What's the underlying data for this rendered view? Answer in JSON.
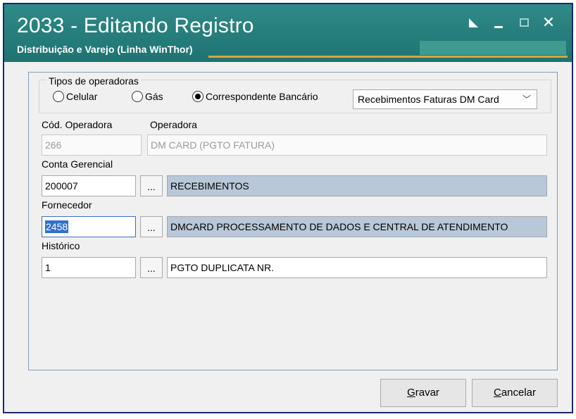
{
  "window": {
    "title": "2033 - Editando Registro",
    "subtitle": "Distribuição e Varejo (Linha WinThor)",
    "close_glyph": "✕"
  },
  "operator_types": {
    "legend": "Tipos de operadoras",
    "options": [
      {
        "label": "Celular",
        "checked": false
      },
      {
        "label": "Gás",
        "checked": false
      },
      {
        "label": "Correspondente Bancário",
        "checked": true
      }
    ],
    "selected_dropdown": "Recebimentos Faturas DM Card",
    "chevron": "﹀"
  },
  "fields": {
    "cod_operadora": {
      "label": "Cód. Operadora",
      "value": "266"
    },
    "operadora": {
      "label": "Operadora",
      "value": "DM CARD (PGTO FATURA)"
    },
    "conta_gerencial": {
      "label": "Conta Gerencial",
      "code": "200007",
      "description": "RECEBIMENTOS"
    },
    "fornecedor": {
      "label": "Fornecedor",
      "code": "2458",
      "description": "DMCARD PROCESSAMENTO DE DADOS E CENTRAL DE ATENDIMENTO"
    },
    "historico": {
      "label": "Histórico",
      "code": "1",
      "description": "PGTO DUPLICATA NR."
    }
  },
  "lookup_button_label": "...",
  "buttons": {
    "save_first": "G",
    "save_rest": "ravar",
    "cancel_first": "C",
    "cancel_rest": "ancelar"
  },
  "colors": {
    "titlebar": "#1e7371",
    "accent_line": "#d9a43a",
    "readonly_field": "#b9c8d8",
    "selection": "#3370cc"
  }
}
